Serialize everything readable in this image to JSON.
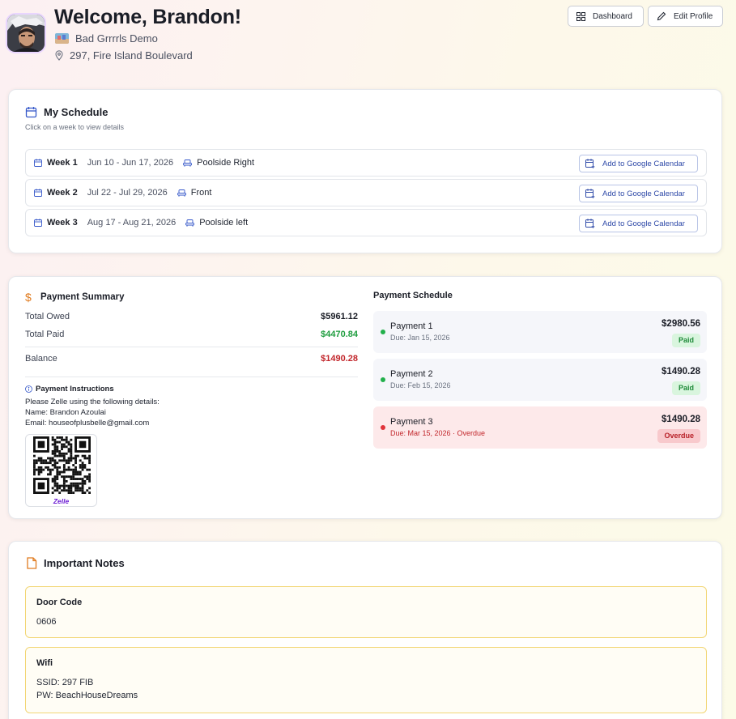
{
  "header": {
    "welcome": "Welcome, Brandon!",
    "team_name": "Bad Grrrrls Demo",
    "address": "297, Fire Island Boulevard",
    "dashboard_label": "Dashboard",
    "edit_profile_label": "Edit Profile"
  },
  "schedule": {
    "title": "My Schedule",
    "subtitle": "Click on a week to view details",
    "weeks": [
      {
        "name": "Week 1",
        "dates": "Jun 10 - Jun 17, 2026",
        "location": "Poolside Right",
        "button": "Add to Google Calendar"
      },
      {
        "name": "Week 2",
        "dates": "Jul 22 - Jul 29, 2026",
        "location": "Front",
        "button": "Add to Google Calendar"
      },
      {
        "name": "Week 3",
        "dates": "Aug 17 - Aug 21, 2026",
        "location": "Poolside left",
        "button": "Add to Google Calendar"
      }
    ]
  },
  "payment_summary": {
    "title": "Payment Summary",
    "total_owed_label": "Total Owed",
    "total_owed": "$5961.12",
    "total_paid_label": "Total Paid",
    "total_paid": "$4470.84",
    "balance_label": "Balance",
    "balance": "$1490.28",
    "instructions_title": "Payment Instructions",
    "instructions_line1": "Please Zelle using the following details:",
    "instructions_name": "Name: Brandon Azoulai",
    "instructions_email": "Email: houseofplusbelle@gmail.com",
    "qr_caption": "Zelle"
  },
  "payment_schedule": {
    "title": "Payment Schedule",
    "payments": [
      {
        "name": "Payment 1",
        "due": "Due: Jan 15, 2026",
        "amount": "$2980.56",
        "status": "Paid"
      },
      {
        "name": "Payment 2",
        "due": "Due: Feb 15, 2026",
        "amount": "$1490.28",
        "status": "Paid"
      },
      {
        "name": "Payment 3",
        "due": "Due: Mar 15, 2026 · Overdue",
        "amount": "$1490.28",
        "status": "Overdue"
      }
    ]
  },
  "notes": {
    "title": "Important Notes",
    "items": [
      {
        "title": "Door Code",
        "lines": [
          "0606"
        ]
      },
      {
        "title": "Wifi",
        "lines": [
          "SSID: 297 FIB",
          "PW: BeachHouseDreams"
        ]
      }
    ]
  },
  "colors": {
    "accent_blue": "#2f4aa8",
    "paid_green": "#1f9d3f",
    "overdue_red": "#c2262b",
    "note_border": "#f2d675",
    "dollar_orange": "#e07b1f"
  }
}
